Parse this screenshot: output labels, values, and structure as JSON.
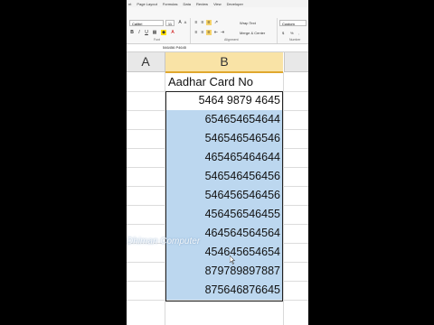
{
  "menu": [
    "nt",
    "Page Layout",
    "Formulas",
    "Data",
    "Review",
    "View",
    "Developer"
  ],
  "ribbon": {
    "font_name": "Calibri",
    "font_size": "11",
    "wrap_text": "Wrap Text",
    "merge_center": "Merge & Center",
    "number_format": "Custom",
    "group_font": "Font",
    "group_alignment": "Alignment",
    "group_number": "Number",
    "currency": "$",
    "percent": "%"
  },
  "formula_bar": {
    "value": "546456 P4645"
  },
  "columns": {
    "a": "A",
    "b": "B",
    "c": ""
  },
  "sheet": {
    "header": "Aadhar Card No",
    "rows": [
      "5464 9879 4645",
      "654654654644",
      "546546546546",
      "465465464644",
      "546546456456",
      "546456546456",
      "456456546455",
      "464564564564",
      "454645654654",
      "879789897887",
      "875646876645"
    ]
  },
  "watermark": "Dhiman Computer",
  "colors": {
    "selection": "#bcd7ef",
    "column_header_active": "#f9e3a6"
  }
}
